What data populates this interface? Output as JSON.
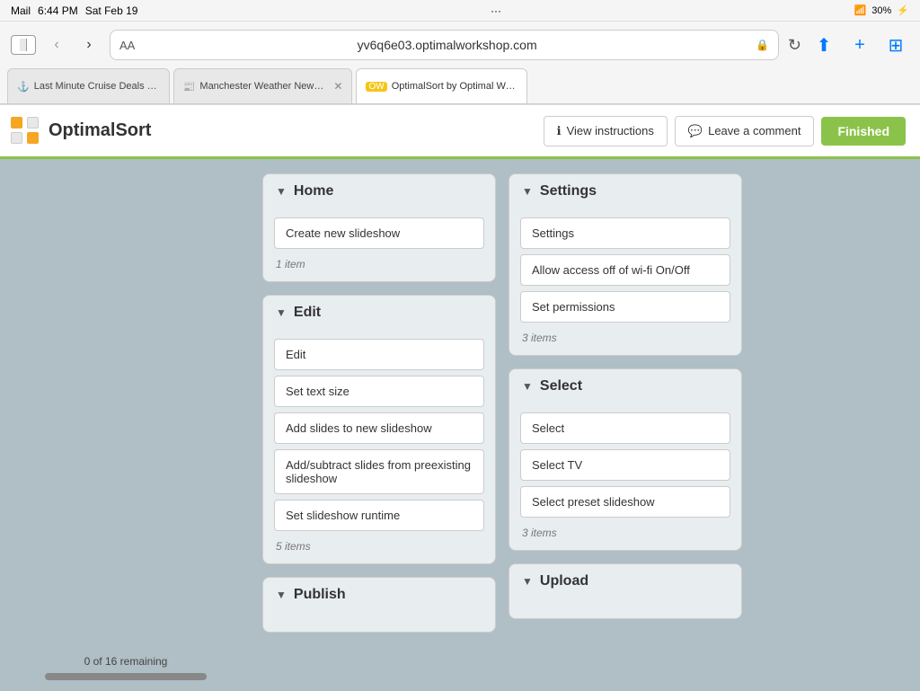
{
  "statusBar": {
    "mail": "Mail",
    "time": "6:44 PM",
    "date": "Sat Feb 19",
    "dots": "···",
    "wifi": "WiFi",
    "battery": "30%"
  },
  "browser": {
    "urlBarAA": "AA",
    "url": "yv6q6e03.optimalworkshop.com",
    "lockIcon": "🔒",
    "tabs": [
      {
        "favicon": "⚓",
        "label": "Last Minute Cruise Deals - Sorted by Depart..."
      },
      {
        "favicon": "📰",
        "label": "Manchester Weather News – New Hampshire...",
        "closable": true
      },
      {
        "favicon": "🟡",
        "label": "OptimalSort by Optimal Workshop",
        "active": true
      }
    ]
  },
  "appHeader": {
    "appName": "OptimalSort",
    "viewInstructionsLabel": "View instructions",
    "leaveCommentLabel": "Leave a comment",
    "finishedLabel": "Finished",
    "infoIcon": "ℹ",
    "commentIcon": "💬"
  },
  "leftPanel": {
    "remaining": "0 of 16 remaining"
  },
  "categories": [
    {
      "id": "home",
      "title": "Home",
      "items": [
        "Create new slideshow"
      ],
      "itemCount": "1 item"
    },
    {
      "id": "edit",
      "title": "Edit",
      "items": [
        "Edit",
        "Set text size",
        "Add slides to new slideshow",
        "Add/subtract slides from preexisting slideshow",
        "Set slideshow runtime"
      ],
      "itemCount": "5 items"
    },
    {
      "id": "publish",
      "title": "Publish",
      "items": [],
      "itemCount": ""
    }
  ],
  "rightCategories": [
    {
      "id": "settings",
      "title": "Settings",
      "items": [
        "Settings",
        "Allow access off of wi-fi On/Off",
        "Set permissions"
      ],
      "itemCount": "3 items"
    },
    {
      "id": "select",
      "title": "Select",
      "items": [
        "Select",
        "Select TV",
        "Select preset slideshow"
      ],
      "itemCount": "3 items"
    },
    {
      "id": "upload",
      "title": "Upload",
      "items": [],
      "itemCount": ""
    }
  ]
}
